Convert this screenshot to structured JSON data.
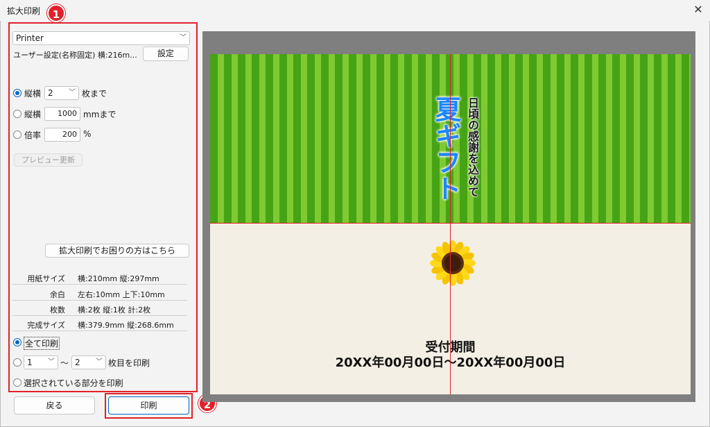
{
  "window": {
    "title": "拡大印刷",
    "close_icon": "close-icon"
  },
  "callouts": {
    "one": "1",
    "two": "2"
  },
  "settings": {
    "printer": "Printer",
    "user_setting": "ユーザー設定(名称固定) 横:216m...",
    "settings_button": "設定",
    "mode1": {
      "label": "縦横",
      "value": "2",
      "suffix": "枚まで",
      "selected": true
    },
    "mode2": {
      "label": "縦横",
      "value": "1000",
      "suffix": "mmまで"
    },
    "mode3": {
      "label": "倍率",
      "value": "200",
      "suffix": "%"
    },
    "preview_update": "プレビュー更新",
    "help_button": "拡大印刷でお困りの方はこちら"
  },
  "info": [
    {
      "label": "用紙サイズ",
      "value": "横:210mm  縦:297mm"
    },
    {
      "label": "余白",
      "value": "左右:10mm 上下:10mm"
    },
    {
      "label": "枚数",
      "value": "横:2枚 縦:1枚   計:2枚"
    },
    {
      "label": "完成サイズ",
      "value": "横:379.9mm 縦:268.6mm"
    }
  ],
  "print_range": {
    "all": "全て印刷",
    "from": "1",
    "tilde": "～",
    "to": "2",
    "range_suffix": "枚目を印刷",
    "selected_part": "選択されている部分を印刷"
  },
  "buttons": {
    "back": "戻る",
    "print": "印刷"
  },
  "preview": {
    "subtitle": "日頃の感謝を込めて",
    "title": "夏ギフト",
    "period_label": "受付期間",
    "period": "20XX年00月00日～20XX年00月00日",
    "colors": {
      "stripe_dark": "#46a315",
      "stripe_light": "#7fca32",
      "page": "#f4efe4",
      "title_blue": "#1e86ff",
      "cut_line": "#e0202a"
    }
  }
}
